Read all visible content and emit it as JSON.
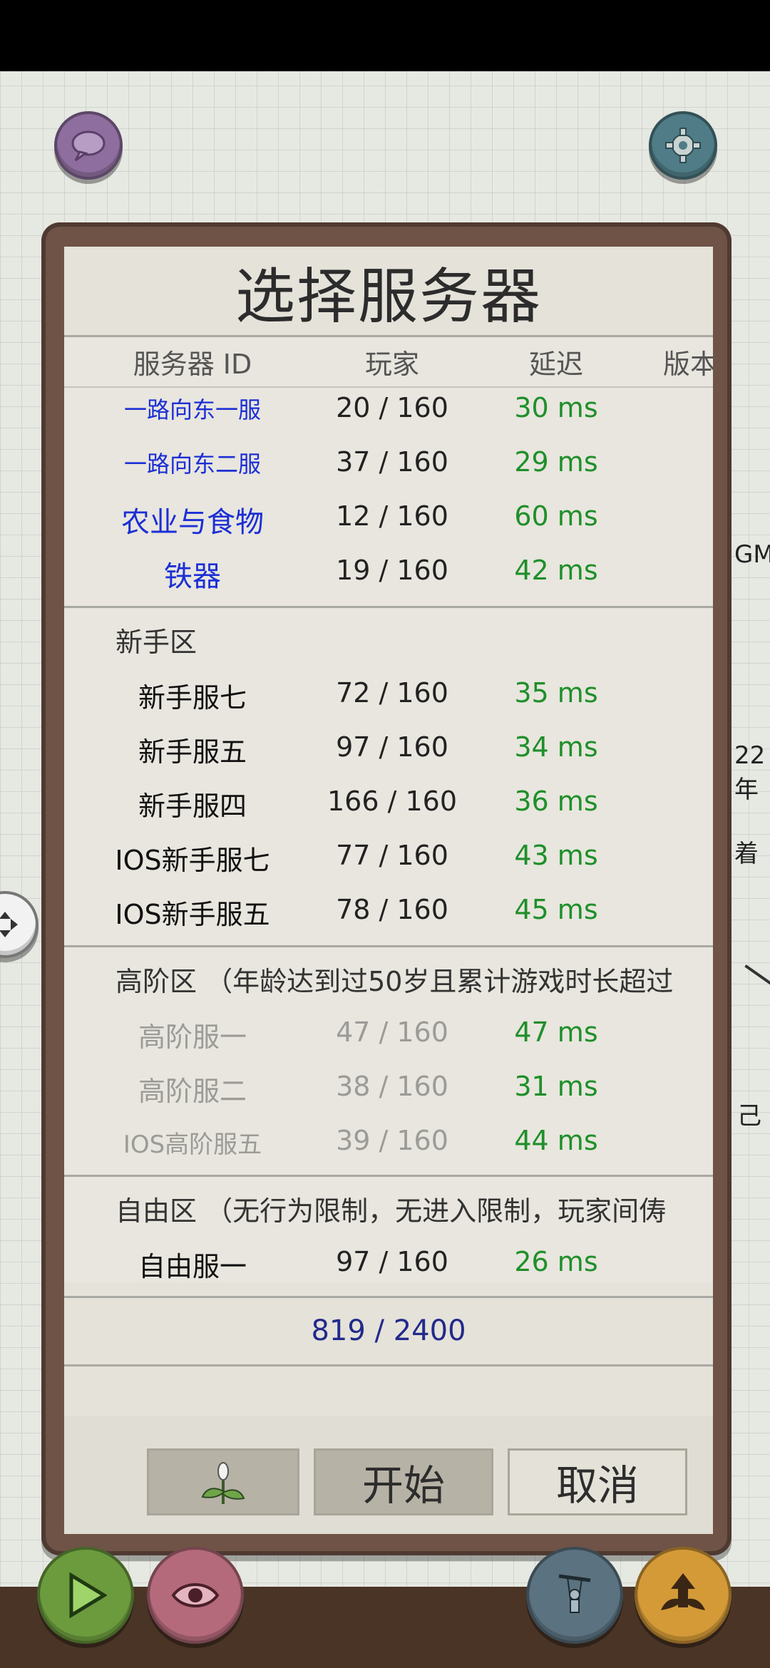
{
  "dialog": {
    "title": "选择服务器",
    "headers": {
      "name": "服务器 ID",
      "players": "玩家",
      "ping": "延迟",
      "version": "版本"
    },
    "featured": [
      {
        "name": "一路向东一服",
        "players": "20 / 160",
        "ping": "30 ms"
      },
      {
        "name": "一路向东二服",
        "players": "37 / 160",
        "ping": "29 ms"
      },
      {
        "name": "农业与食物",
        "players": "12 / 160",
        "ping": "60 ms"
      },
      {
        "name": "铁器",
        "players": "19 / 160",
        "ping": "42 ms"
      }
    ],
    "newbie": {
      "label": "新手区",
      "rows": [
        {
          "name": "新手服七",
          "players": "72 / 160",
          "ping": "35 ms"
        },
        {
          "name": "新手服五",
          "players": "97 / 160",
          "ping": "34 ms"
        },
        {
          "name": "新手服四",
          "players": "166 / 160",
          "ping": "36 ms"
        },
        {
          "name": "IOS新手服七",
          "players": "77 / 160",
          "ping": "43 ms"
        },
        {
          "name": "IOS新手服五",
          "players": "78 / 160",
          "ping": "45 ms"
        }
      ]
    },
    "advanced": {
      "label": "高阶区 （年龄达到过50岁且累计游戏时长超过",
      "rows": [
        {
          "name": "高阶服一",
          "players": "47 / 160",
          "ping": "47 ms"
        },
        {
          "name": "高阶服二",
          "players": "38 / 160",
          "ping": "31 ms"
        },
        {
          "name": "IOS高阶服五",
          "players": "39 / 160",
          "ping": "44 ms"
        }
      ]
    },
    "free": {
      "label": "自由区 （无行为限制，无进入限制，玩家间俦",
      "rows": [
        {
          "name": "自由服一",
          "players": "97 / 160",
          "ping": "26 ms"
        }
      ]
    },
    "total": "819 / 2400",
    "buttons": {
      "start": "开始",
      "cancel": "取消"
    }
  },
  "background_fragments": [
    "GM",
    "22",
    "年",
    "着",
    "己"
  ],
  "colors": {
    "ping_green": "#1f8f2a",
    "featured_blue": "#1c2fd6",
    "frame_brown": "#6e5346"
  }
}
